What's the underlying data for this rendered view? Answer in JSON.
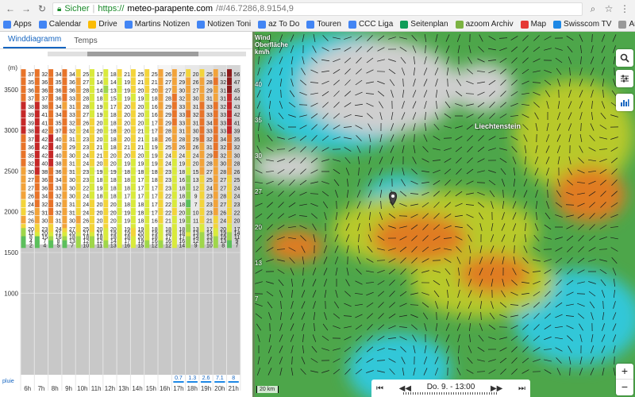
{
  "browser": {
    "secure_label": "Sicher",
    "url_scheme": "https://",
    "url_host": "meteo-parapente.com",
    "url_path": "/#/46.7286,8.9154,9",
    "bookmarks": [
      {
        "label": "Apps",
        "icon": "apps-grid-icon",
        "color": "#4285f4"
      },
      {
        "label": "Calendar",
        "icon": "calendar-icon",
        "color": "#4285f4"
      },
      {
        "label": "Drive",
        "icon": "drive-icon",
        "color": "#fbbc05"
      },
      {
        "label": "Martins Notizen",
        "icon": "doc-icon",
        "color": "#4285f4"
      },
      {
        "label": "Notizen Toni",
        "icon": "doc-icon",
        "color": "#4285f4"
      },
      {
        "label": "az To Do",
        "icon": "doc-icon",
        "color": "#4285f4"
      },
      {
        "label": "Touren",
        "icon": "doc-icon",
        "color": "#4285f4"
      },
      {
        "label": "CCC Liga",
        "icon": "doc-icon",
        "color": "#4285f4"
      },
      {
        "label": "Seitenplan",
        "icon": "sheet-icon",
        "color": "#0f9d58"
      },
      {
        "label": "azoom Archiv",
        "icon": "azoom-icon",
        "color": "#7cb342"
      },
      {
        "label": "Map",
        "icon": "swiss-cross-icon",
        "color": "#e53935"
      },
      {
        "label": "Swisscom TV",
        "icon": "swisscom-icon",
        "color": "#1e88e5"
      }
    ],
    "other_bookmarks": "Andere Lesezeichen"
  },
  "left": {
    "tabs": [
      {
        "label": "Winddiagramm",
        "active": true
      },
      {
        "label": "Temps",
        "active": false
      }
    ]
  },
  "chart_data": {
    "type": "heatmap",
    "title": "",
    "ylabel": "(m)",
    "xlabel": "",
    "y_ticks": [
      1000,
      1500,
      2000,
      2500,
      3000,
      3500
    ],
    "x_labels": [
      "6h",
      "7h",
      "8h",
      "9h",
      "10h",
      "11h",
      "12h",
      "13h",
      "14h",
      "15h",
      "16h",
      "17h",
      "18h",
      "19h",
      "20h",
      "21h"
    ],
    "altitude_levels": [
      3700,
      3600,
      3500,
      3400,
      3300,
      3200,
      3100,
      3000,
      2900,
      2800,
      2700,
      2600,
      2500,
      2400,
      2300,
      2200,
      2100,
      2000,
      1900,
      1800,
      1750,
      1700,
      1650,
      1600
    ],
    "ylim": [
      0,
      3800
    ],
    "ground_level": 1600,
    "pluie_label": "pluie",
    "rain": [
      "",
      "",
      "",
      "",
      "",
      "",
      "",
      "",
      "",
      "",
      "",
      "0.7",
      "1.3",
      "2.6",
      "7.1",
      "8"
    ],
    "speeds": [
      [
        37,
        32,
        34,
        34,
        25,
        17,
        18,
        21,
        25,
        25,
        26,
        27,
        20,
        25,
        31,
        56
      ],
      [
        35,
        36,
        35,
        36,
        27,
        14,
        14,
        19,
        21,
        21,
        27,
        29,
        26,
        28,
        32,
        47
      ],
      [
        36,
        36,
        36,
        36,
        28,
        14,
        13,
        19,
        20,
        20,
        27,
        30,
        27,
        29,
        31,
        45
      ],
      [
        37,
        37,
        36,
        33,
        28,
        18,
        15,
        19,
        19,
        18,
        28,
        32,
        30,
        31,
        31,
        44
      ],
      [
        38,
        38,
        34,
        31,
        28,
        19,
        17,
        20,
        20,
        16,
        29,
        33,
        31,
        33,
        32,
        43
      ],
      [
        39,
        41,
        34,
        33,
        27,
        19,
        18,
        20,
        20,
        16,
        29,
        33,
        32,
        33,
        33,
        42
      ],
      [
        39,
        41,
        35,
        32,
        26,
        20,
        18,
        20,
        20,
        17,
        29,
        33,
        31,
        34,
        33,
        41
      ],
      [
        38,
        42,
        37,
        32,
        24,
        20,
        18,
        20,
        21,
        17,
        28,
        31,
        30,
        33,
        33,
        39
      ],
      [
        37,
        42,
        40,
        31,
        23,
        20,
        18,
        20,
        21,
        18,
        26,
        28,
        29,
        32,
        34,
        35
      ],
      [
        36,
        42,
        40,
        29,
        23,
        21,
        18,
        21,
        21,
        19,
        25,
        26,
        26,
        31,
        32,
        32
      ],
      [
        35,
        42,
        40,
        30,
        24,
        21,
        20,
        20,
        20,
        19,
        24,
        24,
        24,
        29,
        32,
        30
      ],
      [
        32,
        40,
        38,
        31,
        24,
        20,
        20,
        19,
        19,
        19,
        24,
        19,
        20,
        28,
        30,
        28
      ],
      [
        30,
        38,
        36,
        31,
        23,
        19,
        19,
        18,
        18,
        18,
        23,
        18,
        15,
        27,
        28,
        26
      ],
      [
        27,
        36,
        34,
        30,
        23,
        18,
        18,
        18,
        17,
        18,
        23,
        16,
        13,
        25,
        27,
        25
      ],
      [
        27,
        36,
        33,
        30,
        22,
        19,
        18,
        18,
        17,
        17,
        23,
        18,
        12,
        24,
        27,
        24
      ],
      [
        26,
        34,
        32,
        30,
        24,
        18,
        18,
        17,
        17,
        17,
        22,
        18,
        9,
        23,
        28,
        24
      ],
      [
        24,
        32,
        32,
        31,
        24,
        20,
        20,
        18,
        18,
        17,
        22,
        18,
        7,
        23,
        27,
        23
      ],
      [
        25,
        31,
        32,
        31,
        24,
        20,
        20,
        19,
        18,
        17,
        22,
        20,
        10,
        23,
        26,
        22
      ],
      [
        26,
        30,
        31,
        30,
        26,
        20,
        20,
        19,
        18,
        16,
        21,
        19,
        11,
        21,
        24,
        20
      ],
      [
        20,
        23,
        24,
        27,
        25,
        20,
        20,
        19,
        19,
        18,
        18,
        18,
        13,
        17,
        20,
        17
      ],
      [
        11,
        20,
        21,
        20,
        21,
        21,
        19,
        19,
        20,
        19,
        18,
        18,
        13,
        14,
        19,
        14
      ],
      [
        8,
        15,
        16,
        18,
        18,
        18,
        18,
        18,
        20,
        18,
        17,
        17,
        14,
        13,
        19,
        11
      ],
      [
        4,
        7,
        8,
        13,
        12,
        12,
        14,
        17,
        19,
        16,
        16,
        16,
        12,
        13,
        13,
        9
      ],
      [
        2,
        4,
        5,
        7,
        10,
        11,
        13,
        16,
        15,
        12,
        12,
        14,
        9,
        10,
        8,
        7
      ]
    ]
  },
  "map": {
    "legend_title": "Wind Oberfläche",
    "legend_unit": "km/h",
    "legend_values": [
      "40",
      "35",
      "30",
      "27",
      "20",
      "13",
      "7"
    ],
    "places": {
      "liechtenstein": "Liechtenstein"
    },
    "scale_label": "20 km",
    "player_label": "Do. 9. - 13:00",
    "zoom_in": "+",
    "zoom_out": "−",
    "colors": {
      "calm": "#31c7d8",
      "light": "#4da64a",
      "moderate": "#b8c92a",
      "strong": "#e07b24",
      "clouds": "#cfcfcf"
    }
  }
}
